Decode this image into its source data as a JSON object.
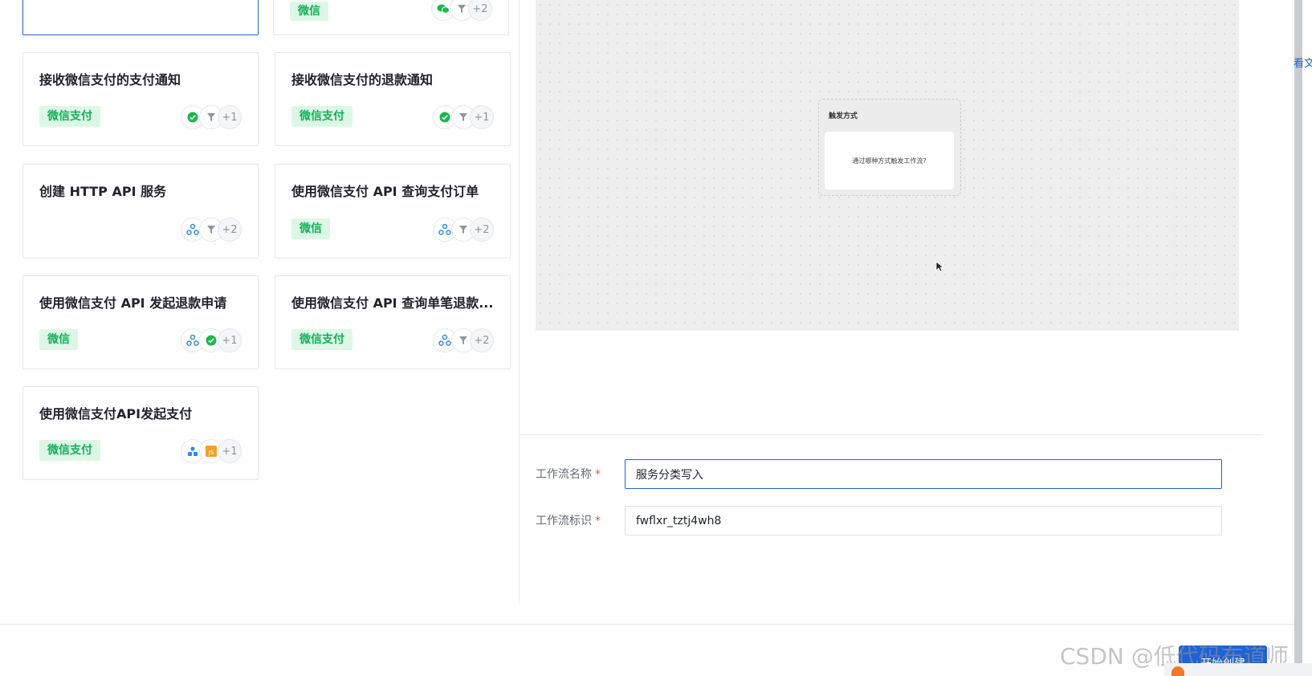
{
  "cards": [
    {
      "title": "",
      "tag": "",
      "icons": [],
      "more": ""
    },
    {
      "title": "",
      "tag": "微信",
      "icons": [
        "wechat-icon",
        "filter-icon"
      ],
      "more": "+2"
    },
    {
      "title": "接收微信支付的支付通知",
      "tag": "微信支付",
      "icons": [
        "wechat-pay-icon",
        "filter-icon"
      ],
      "more": "+1"
    },
    {
      "title": "接收微信支付的退款通知",
      "tag": "微信支付",
      "icons": [
        "wechat-pay-icon",
        "filter-icon"
      ],
      "more": "+1"
    },
    {
      "title": "创建 HTTP API 服务",
      "tag": "",
      "icons": [
        "webhook-icon",
        "filter-icon"
      ],
      "more": "+2"
    },
    {
      "title": "使用微信支付 API 查询支付订单",
      "tag": "微信",
      "icons": [
        "webhook-icon",
        "filter-icon"
      ],
      "more": "+2"
    },
    {
      "title": "使用微信支付 API 发起退款申请",
      "tag": "微信",
      "icons": [
        "webhook-icon",
        "wechat-pay-icon"
      ],
      "more": "+1"
    },
    {
      "title": "使用微信支付 API 查询单笔退款...",
      "tag": "微信支付",
      "icons": [
        "webhook-icon",
        "filter-icon"
      ],
      "more": "+2"
    },
    {
      "title": "使用微信支付API发起支付",
      "tag": "微信支付",
      "icons": [
        "user-group-icon",
        "js-script-icon"
      ],
      "more": "+1"
    }
  ],
  "preview": {
    "node_title": "触发方式",
    "node_prompt": "通过哪种方式触发工作流?"
  },
  "form": {
    "name_label": "工作流名称",
    "name_value": "服务分类写入",
    "id_label": "工作流标识",
    "id_value": "fwflxr_tztj4wh8",
    "required_mark": "*"
  },
  "footer": {
    "create_label": "开始创建",
    "watermark": "CSDN @低代码布道师"
  },
  "side": {
    "cut_text": "看文"
  },
  "colors": {
    "accent": "#1e63d6",
    "tag_bg": "#ddf7e6",
    "tag_text": "#13b05a",
    "required": "#f54a45"
  }
}
